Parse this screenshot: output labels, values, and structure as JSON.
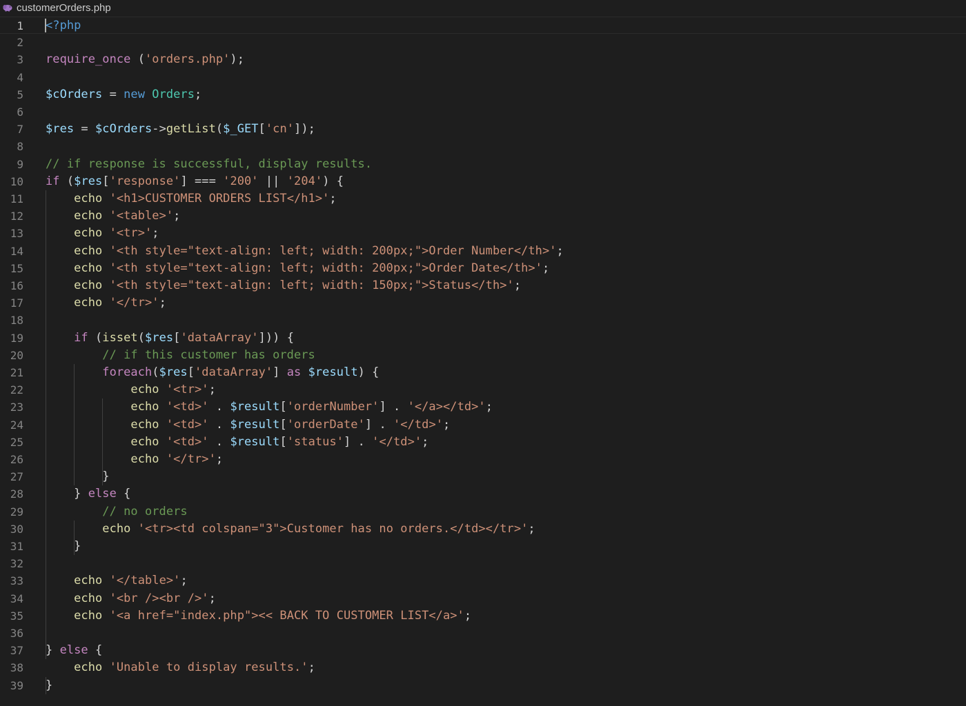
{
  "tab": {
    "title": "customerOrders.php",
    "icon": "php-elephant-icon"
  },
  "editor": {
    "active_line": 1,
    "colors": {
      "background": "#1e1e1e",
      "tag": "#569cd6",
      "keyword": "#c586c0",
      "function": "#dcdcaa",
      "string": "#ce9178",
      "variable": "#9cdcfe",
      "class": "#4ec9b0",
      "comment": "#6a9955",
      "plain": "#d4d4d4",
      "line_number": "#858585"
    },
    "lines": [
      {
        "n": "1",
        "tokens": [
          [
            "tag",
            "<?php"
          ]
        ]
      },
      {
        "n": "2",
        "tokens": []
      },
      {
        "n": "3",
        "tokens": [
          [
            "kw",
            "require_once"
          ],
          [
            "pun",
            " ("
          ],
          [
            "str",
            "'orders.php'"
          ],
          [
            "pun",
            ");"
          ]
        ]
      },
      {
        "n": "4",
        "tokens": []
      },
      {
        "n": "5",
        "tokens": [
          [
            "var",
            "$cOrders"
          ],
          [
            "pun",
            " = "
          ],
          [
            "new",
            "new"
          ],
          [
            "pun",
            " "
          ],
          [
            "cls",
            "Orders"
          ],
          [
            "pun",
            ";"
          ]
        ]
      },
      {
        "n": "6",
        "tokens": []
      },
      {
        "n": "7",
        "tokens": [
          [
            "var",
            "$res"
          ],
          [
            "pun",
            " = "
          ],
          [
            "var",
            "$cOrders"
          ],
          [
            "pun",
            "->"
          ],
          [
            "fn",
            "getList"
          ],
          [
            "pun",
            "("
          ],
          [
            "var",
            "$_GET"
          ],
          [
            "pun",
            "["
          ],
          [
            "str",
            "'cn'"
          ],
          [
            "pun",
            "]);"
          ]
        ]
      },
      {
        "n": "8",
        "tokens": []
      },
      {
        "n": "9",
        "tokens": [
          [
            "com",
            "// if response is successful, display results."
          ]
        ]
      },
      {
        "n": "10",
        "tokens": [
          [
            "kw",
            "if"
          ],
          [
            "pun",
            " ("
          ],
          [
            "var",
            "$res"
          ],
          [
            "pun",
            "["
          ],
          [
            "str",
            "'response'"
          ],
          [
            "pun",
            "] === "
          ],
          [
            "str",
            "'200'"
          ],
          [
            "pun",
            " || "
          ],
          [
            "str",
            "'204'"
          ],
          [
            "pun",
            ") {"
          ]
        ]
      },
      {
        "n": "11",
        "tokens": [
          [
            "pun",
            "    "
          ],
          [
            "fn",
            "echo"
          ],
          [
            "pun",
            " "
          ],
          [
            "str",
            "'<h1>CUSTOMER ORDERS LIST</h1>'"
          ],
          [
            "pun",
            ";"
          ]
        ]
      },
      {
        "n": "12",
        "tokens": [
          [
            "pun",
            "    "
          ],
          [
            "fn",
            "echo"
          ],
          [
            "pun",
            " "
          ],
          [
            "str",
            "'<table>'"
          ],
          [
            "pun",
            ";"
          ]
        ]
      },
      {
        "n": "13",
        "tokens": [
          [
            "pun",
            "    "
          ],
          [
            "fn",
            "echo"
          ],
          [
            "pun",
            " "
          ],
          [
            "str",
            "'<tr>'"
          ],
          [
            "pun",
            ";"
          ]
        ]
      },
      {
        "n": "14",
        "tokens": [
          [
            "pun",
            "    "
          ],
          [
            "fn",
            "echo"
          ],
          [
            "pun",
            " "
          ],
          [
            "str",
            "'<th style=\"text-align: left; width: 200px;\">Order Number</th>'"
          ],
          [
            "pun",
            ";"
          ]
        ]
      },
      {
        "n": "15",
        "tokens": [
          [
            "pun",
            "    "
          ],
          [
            "fn",
            "echo"
          ],
          [
            "pun",
            " "
          ],
          [
            "str",
            "'<th style=\"text-align: left; width: 200px;\">Order Date</th>'"
          ],
          [
            "pun",
            ";"
          ]
        ]
      },
      {
        "n": "16",
        "tokens": [
          [
            "pun",
            "    "
          ],
          [
            "fn",
            "echo"
          ],
          [
            "pun",
            " "
          ],
          [
            "str",
            "'<th style=\"text-align: left; width: 150px;\">Status</th>'"
          ],
          [
            "pun",
            ";"
          ]
        ]
      },
      {
        "n": "17",
        "tokens": [
          [
            "pun",
            "    "
          ],
          [
            "fn",
            "echo"
          ],
          [
            "pun",
            " "
          ],
          [
            "str",
            "'</tr>'"
          ],
          [
            "pun",
            ";"
          ]
        ]
      },
      {
        "n": "18",
        "tokens": []
      },
      {
        "n": "19",
        "tokens": [
          [
            "pun",
            "    "
          ],
          [
            "kw",
            "if"
          ],
          [
            "pun",
            " ("
          ],
          [
            "fn",
            "isset"
          ],
          [
            "pun",
            "("
          ],
          [
            "var",
            "$res"
          ],
          [
            "pun",
            "["
          ],
          [
            "str",
            "'dataArray'"
          ],
          [
            "pun",
            "])) {"
          ]
        ]
      },
      {
        "n": "20",
        "tokens": [
          [
            "pun",
            "        "
          ],
          [
            "com",
            "// if this customer has orders"
          ]
        ]
      },
      {
        "n": "21",
        "tokens": [
          [
            "pun",
            "        "
          ],
          [
            "kw",
            "foreach"
          ],
          [
            "pun",
            "("
          ],
          [
            "var",
            "$res"
          ],
          [
            "pun",
            "["
          ],
          [
            "str",
            "'dataArray'"
          ],
          [
            "pun",
            "] "
          ],
          [
            "kw",
            "as"
          ],
          [
            "pun",
            " "
          ],
          [
            "var",
            "$result"
          ],
          [
            "pun",
            ") {"
          ]
        ]
      },
      {
        "n": "22",
        "tokens": [
          [
            "pun",
            "            "
          ],
          [
            "fn",
            "echo"
          ],
          [
            "pun",
            " "
          ],
          [
            "str",
            "'<tr>'"
          ],
          [
            "pun",
            ";"
          ]
        ]
      },
      {
        "n": "23",
        "tokens": [
          [
            "pun",
            "            "
          ],
          [
            "fn",
            "echo"
          ],
          [
            "pun",
            " "
          ],
          [
            "str",
            "'<td>'"
          ],
          [
            "pun",
            " . "
          ],
          [
            "var",
            "$result"
          ],
          [
            "pun",
            "["
          ],
          [
            "str",
            "'orderNumber'"
          ],
          [
            "pun",
            "] . "
          ],
          [
            "str",
            "'</a></td>'"
          ],
          [
            "pun",
            ";"
          ]
        ]
      },
      {
        "n": "24",
        "tokens": [
          [
            "pun",
            "            "
          ],
          [
            "fn",
            "echo"
          ],
          [
            "pun",
            " "
          ],
          [
            "str",
            "'<td>'"
          ],
          [
            "pun",
            " . "
          ],
          [
            "var",
            "$result"
          ],
          [
            "pun",
            "["
          ],
          [
            "str",
            "'orderDate'"
          ],
          [
            "pun",
            "] . "
          ],
          [
            "str",
            "'</td>'"
          ],
          [
            "pun",
            ";"
          ]
        ]
      },
      {
        "n": "25",
        "tokens": [
          [
            "pun",
            "            "
          ],
          [
            "fn",
            "echo"
          ],
          [
            "pun",
            " "
          ],
          [
            "str",
            "'<td>'"
          ],
          [
            "pun",
            " . "
          ],
          [
            "var",
            "$result"
          ],
          [
            "pun",
            "["
          ],
          [
            "str",
            "'status'"
          ],
          [
            "pun",
            "] . "
          ],
          [
            "str",
            "'</td>'"
          ],
          [
            "pun",
            ";"
          ]
        ]
      },
      {
        "n": "26",
        "tokens": [
          [
            "pun",
            "            "
          ],
          [
            "fn",
            "echo"
          ],
          [
            "pun",
            " "
          ],
          [
            "str",
            "'</tr>'"
          ],
          [
            "pun",
            ";"
          ]
        ]
      },
      {
        "n": "27",
        "tokens": [
          [
            "pun",
            "        }"
          ]
        ]
      },
      {
        "n": "28",
        "tokens": [
          [
            "pun",
            "    } "
          ],
          [
            "kw",
            "else"
          ],
          [
            "pun",
            " {"
          ]
        ]
      },
      {
        "n": "29",
        "tokens": [
          [
            "pun",
            "        "
          ],
          [
            "com",
            "// no orders"
          ]
        ]
      },
      {
        "n": "30",
        "tokens": [
          [
            "pun",
            "        "
          ],
          [
            "fn",
            "echo"
          ],
          [
            "pun",
            " "
          ],
          [
            "str",
            "'<tr><td colspan=\"3\">Customer has no orders.</td></tr>'"
          ],
          [
            "pun",
            ";"
          ]
        ]
      },
      {
        "n": "31",
        "tokens": [
          [
            "pun",
            "    }"
          ]
        ]
      },
      {
        "n": "32",
        "tokens": []
      },
      {
        "n": "33",
        "tokens": [
          [
            "pun",
            "    "
          ],
          [
            "fn",
            "echo"
          ],
          [
            "pun",
            " "
          ],
          [
            "str",
            "'</table>'"
          ],
          [
            "pun",
            ";"
          ]
        ]
      },
      {
        "n": "34",
        "tokens": [
          [
            "pun",
            "    "
          ],
          [
            "fn",
            "echo"
          ],
          [
            "pun",
            " "
          ],
          [
            "str",
            "'<br /><br />'"
          ],
          [
            "pun",
            ";"
          ]
        ]
      },
      {
        "n": "35",
        "tokens": [
          [
            "pun",
            "    "
          ],
          [
            "fn",
            "echo"
          ],
          [
            "pun",
            " "
          ],
          [
            "str",
            "'<a href=\"index.php\"><< BACK TO CUSTOMER LIST</a>'"
          ],
          [
            "pun",
            ";"
          ]
        ]
      },
      {
        "n": "36",
        "tokens": []
      },
      {
        "n": "37",
        "tokens": [
          [
            "pun",
            "} "
          ],
          [
            "kw",
            "else"
          ],
          [
            "pun",
            " {"
          ]
        ]
      },
      {
        "n": "38",
        "tokens": [
          [
            "pun",
            "    "
          ],
          [
            "fn",
            "echo"
          ],
          [
            "pun",
            " "
          ],
          [
            "str",
            "'Unable to display results.'"
          ],
          [
            "pun",
            ";"
          ]
        ]
      },
      {
        "n": "39",
        "tokens": [
          [
            "pun",
            "}"
          ]
        ]
      }
    ]
  }
}
